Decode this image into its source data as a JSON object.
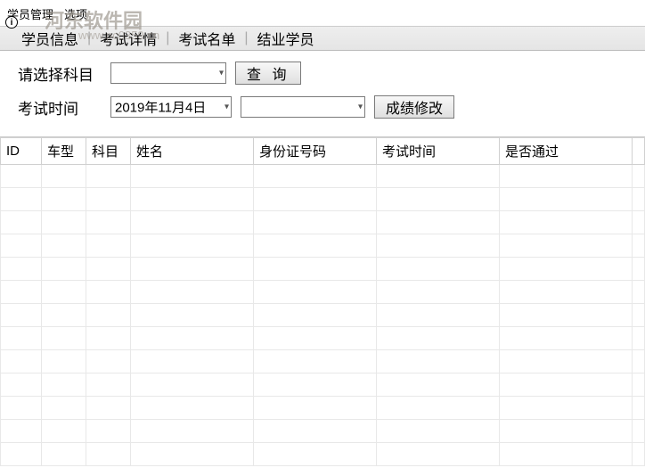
{
  "menu": {
    "items": [
      "学员管理",
      "选项"
    ]
  },
  "watermark": {
    "title": "河东软件园",
    "url": "www.pc0359.cn"
  },
  "subnav": {
    "items": [
      "学员信息",
      "考试详情",
      "考试名单",
      "结业学员"
    ]
  },
  "filters": {
    "subject_label": "请选择科目",
    "search_btn": "查  询",
    "exam_time_label": "考试时间",
    "date_value": "2019年11月4日",
    "grade_btn": "成绩修改"
  },
  "table": {
    "headers": {
      "id": "ID",
      "cartype": "车型",
      "subject": "科目",
      "name": "姓名",
      "idcard": "身份证号码",
      "examtime": "考试时间",
      "pass": "是否通过"
    },
    "rows": []
  }
}
